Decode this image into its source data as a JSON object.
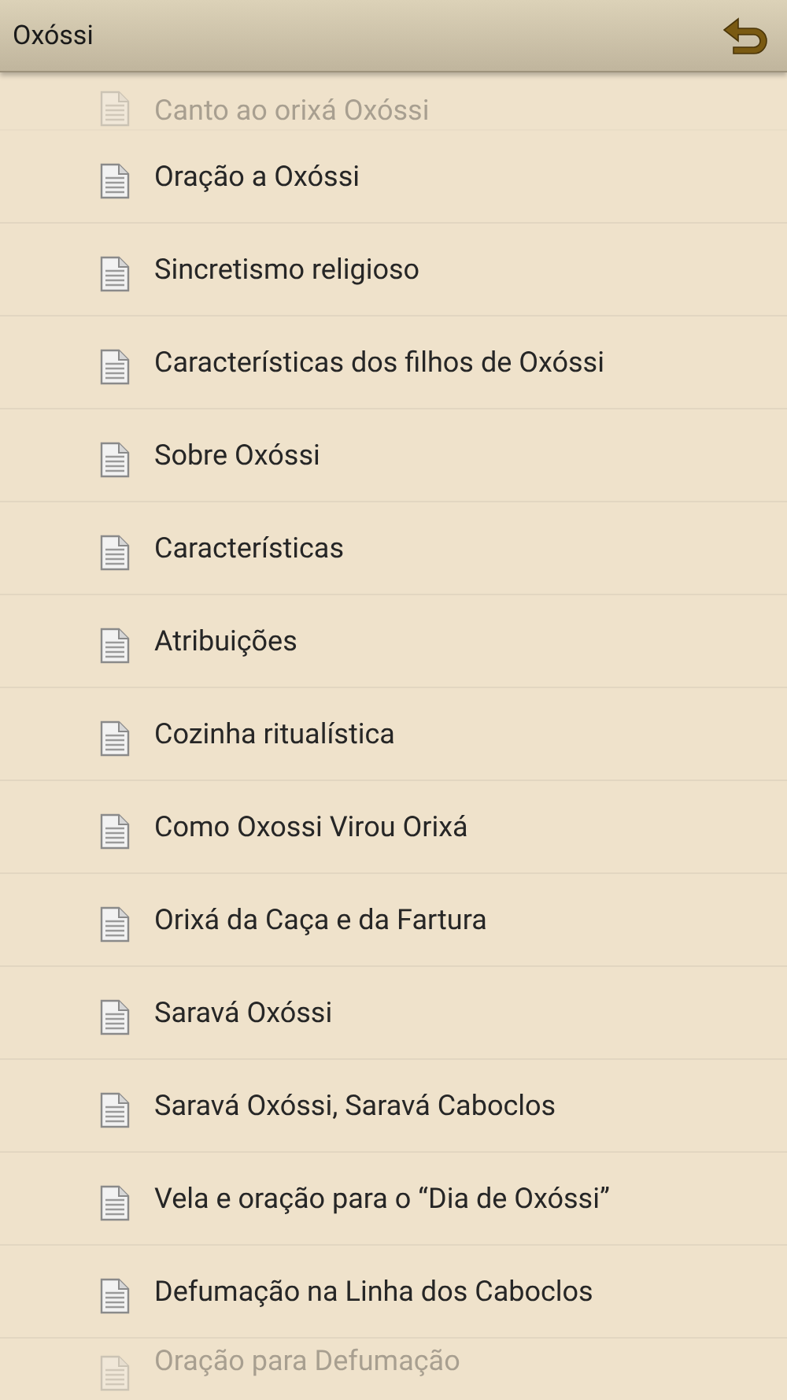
{
  "header": {
    "title": "Oxóssi"
  },
  "items": [
    {
      "label": "Canto ao orixá Oxóssi",
      "faded": true
    },
    {
      "label": "Oração a Oxóssi",
      "faded": false
    },
    {
      "label": "Sincretismo religioso",
      "faded": false
    },
    {
      "label": "Características dos filhos de Oxóssi",
      "faded": false
    },
    {
      "label": "Sobre Oxóssi",
      "faded": false
    },
    {
      "label": "Características",
      "faded": false
    },
    {
      "label": "Atribuições",
      "faded": false
    },
    {
      "label": "Cozinha ritualística",
      "faded": false
    },
    {
      "label": "Como Oxossi Virou Orixá",
      "faded": false
    },
    {
      "label": "Orixá da Caça e da Fartura",
      "faded": false
    },
    {
      "label": "Saravá Oxóssi",
      "faded": false
    },
    {
      "label": "Saravá Oxóssi, Saravá Caboclos",
      "faded": false
    },
    {
      "label": "Vela e oração para o “Dia de Oxóssi”",
      "faded": false
    },
    {
      "label": "Defumação na Linha dos Caboclos",
      "faded": false
    },
    {
      "label": "Oração para Defumação",
      "faded": true
    }
  ]
}
